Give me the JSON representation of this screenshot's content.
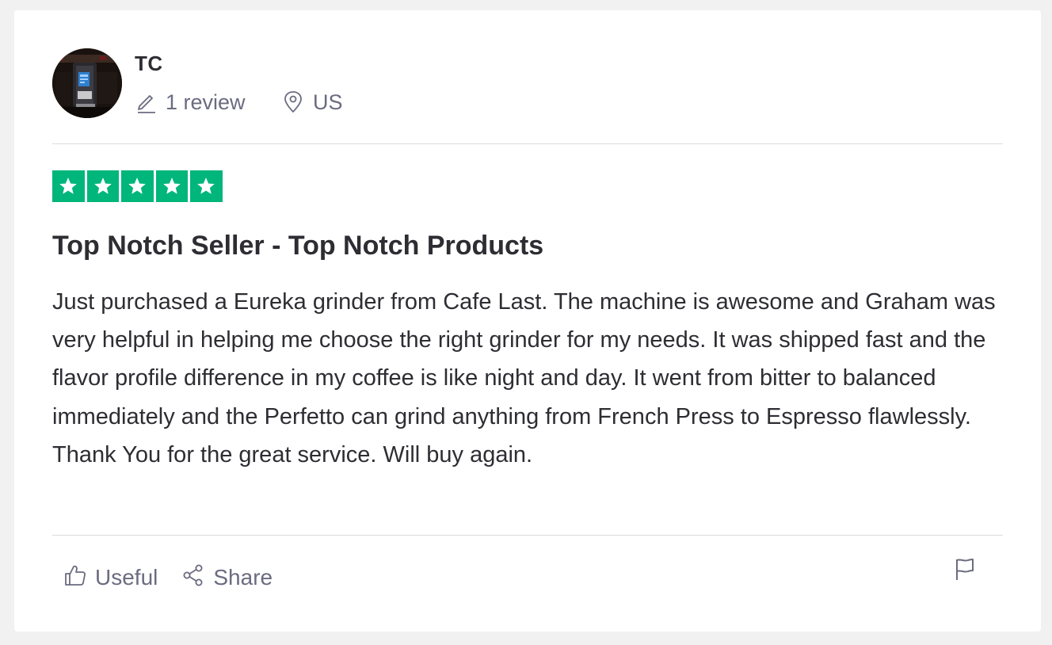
{
  "reviewer": {
    "name": "TC",
    "review_count": "1 review",
    "country": "US",
    "avatar_icon": "espresso-machine-photo"
  },
  "rating": {
    "stars": 5,
    "max": 5,
    "color": "#00b67a"
  },
  "review": {
    "title": "Top Notch Seller - Top Notch Products",
    "body": "Just purchased a Eureka grinder from Cafe Last. The machine is awesome and Graham was very helpful in helping me choose the right grinder for my needs. It was shipped fast and the flavor profile difference in my coffee is like night and day. It went from bitter to balanced immediately and the Perfetto can grind anything from French Press to Espresso flawlessly. Thank You for the great service. Will buy again."
  },
  "actions": {
    "useful_label": "Useful",
    "share_label": "Share",
    "useful_icon": "thumbs-up-icon",
    "share_icon": "share-icon",
    "flag_icon": "flag-icon"
  },
  "colors": {
    "text": "#2d2d33",
    "muted": "#6b6b80",
    "star_green": "#00b67a"
  }
}
